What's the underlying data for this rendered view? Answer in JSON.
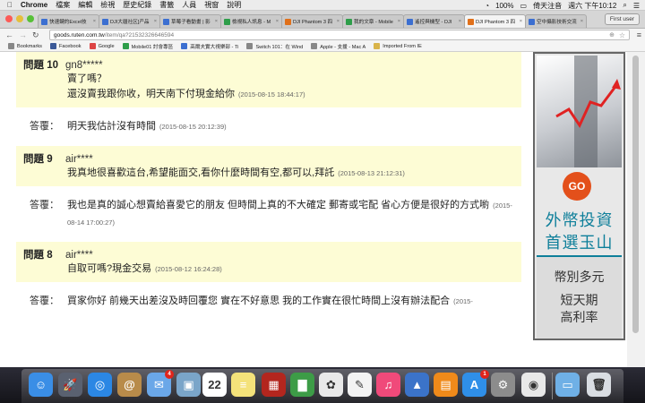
{
  "menubar": {
    "app": "Chrome",
    "items": [
      "檔案",
      "編輯",
      "檢視",
      "歷史紀錄",
      "書籤",
      "人員",
      "視窗",
      "說明"
    ],
    "status": {
      "battery": "100%",
      "input": "倚天注音",
      "datetime": "週六 下午10:12"
    }
  },
  "tabs": [
    {
      "label": "快速鍵的Excel技",
      "color": "#3c6fd1"
    },
    {
      "label": "DJI大疆社区]产品",
      "color": "#3c6fd1"
    },
    {
      "label": "草莓子看動畫 | 影",
      "color": "#3c6fd1"
    },
    {
      "label": "檢視私人訊息 - M",
      "color": "#2e9e4a"
    },
    {
      "label": "DJI Phantom 3 四",
      "color": "#e0701a"
    },
    {
      "label": "我的文章 - Mobile",
      "color": "#2e9e4a"
    },
    {
      "label": "遙控與機型 - DJI",
      "color": "#3c6fd1"
    },
    {
      "label": "DJI Phantom 3 四",
      "color": "#e0701a"
    },
    {
      "label": "空中攝影技術交流",
      "color": "#3c6fd1"
    }
  ],
  "active_tab": 7,
  "user_button": "First user",
  "url": {
    "host": "goods.ruten.com.tw",
    "path": "/item/qa?21532326646594"
  },
  "bookmarks": [
    {
      "label": "Bookmarks",
      "color": "#888"
    },
    {
      "label": "Facebook",
      "color": "#3b5998"
    },
    {
      "label": "Google",
      "color": "#d44"
    },
    {
      "label": "Mobile01 討會專區",
      "color": "#2e9e4a"
    },
    {
      "label": "高爾夫實大視樂部 - Ti",
      "color": "#3c6fd1"
    },
    {
      "label": "Switch 101：在 Wind",
      "color": "#888"
    },
    {
      "label": "Apple - 支援 - Mac A",
      "color": "#888"
    },
    {
      "label": "Imported From IE",
      "color": "#d9b44a"
    }
  ],
  "qa": [
    {
      "type": "q",
      "label": "問題",
      "num": "10",
      "user": "gn8*****",
      "lines": [
        {
          "text": "賣了嗎？",
          "date": ""
        },
        {
          "text": "還沒賣我跟你收，明天南下付現金給你",
          "date": "(2015-08-15 18:44:17)"
        }
      ]
    },
    {
      "type": "a",
      "label": "答覆：",
      "text": "明天我估計沒有時間",
      "date": "(2015-08-15 20:12:39)"
    },
    {
      "type": "q",
      "label": "問題",
      "num": "9",
      "user": "air****",
      "lines": [
        {
          "text": "我真地很喜歡這台,希望能面交,看你什麼時間有空,都可以,拜託",
          "date": "(2015-08-13 21:12:31)"
        }
      ]
    },
    {
      "type": "a",
      "label": "答覆：",
      "text": "我也是真的誠心想賣給喜愛它的朋友 但時間上真的不大確定 郵寄或宅配 省心方便是很好的方式喲",
      "date": "(2015-08-14 17:00:27)"
    },
    {
      "type": "q",
      "label": "問題",
      "num": "8",
      "user": "air****",
      "lines": [
        {
          "text": "自取可嗎?現金交易",
          "date": "(2015-08-12 16:24:28)"
        }
      ]
    },
    {
      "type": "a",
      "label": "答覆：",
      "text": "買家你好 前幾天出差沒及時回覆您 實在不好意思 我的工作實在很忙時間上沒有辦法配合",
      "date": "(2015-"
    }
  ],
  "ad": {
    "go": "GO",
    "line1": "外幣投資",
    "line2": "首選玉山",
    "line3": "幣別多元",
    "line4": "短天期",
    "line5": "高利率",
    "accent": "#0e7f9a"
  },
  "dock": [
    {
      "name": "finder-icon",
      "color": "#3a8ee6",
      "glyph": "☺"
    },
    {
      "name": "launchpad-icon",
      "color": "#5a6170",
      "glyph": "🚀"
    },
    {
      "name": "safari-icon",
      "color": "#2b87e4",
      "glyph": "◎"
    },
    {
      "name": "contacts-icon",
      "color": "#b88b4a",
      "glyph": "@"
    },
    {
      "name": "mail-icon",
      "color": "#6aa7e8",
      "glyph": "✉",
      "badge": "4"
    },
    {
      "name": "preview-icon",
      "color": "#7aa5c9",
      "glyph": "▣"
    },
    {
      "name": "calendar-icon",
      "color": "#ffffff",
      "glyph": "22"
    },
    {
      "name": "notes-icon",
      "color": "#f4e27a",
      "glyph": "≡"
    },
    {
      "name": "photo-booth-icon",
      "color": "#b3261e",
      "glyph": "▦"
    },
    {
      "name": "numbers-icon",
      "color": "#3d9c47",
      "glyph": "▇"
    },
    {
      "name": "photos-icon",
      "color": "#e9e9e9",
      "glyph": "✿"
    },
    {
      "name": "textedit-icon",
      "color": "#f3f3f3",
      "glyph": "✎"
    },
    {
      "name": "itunes-icon",
      "color": "#f04a7a",
      "glyph": "♫"
    },
    {
      "name": "keynote-icon",
      "color": "#3b73c9",
      "glyph": "▲"
    },
    {
      "name": "ibooks-icon",
      "color": "#f08a1a",
      "glyph": "▤"
    },
    {
      "name": "app-store-icon",
      "color": "#2f8fe8",
      "glyph": "A",
      "badge": "1"
    },
    {
      "name": "system-preferences-icon",
      "color": "#8c8c8c",
      "glyph": "⚙"
    },
    {
      "name": "chrome-icon",
      "color": "#e8e8e8",
      "glyph": "◉"
    },
    {
      "name": "downloads-folder-icon",
      "color": "#6fb0e6",
      "glyph": "▭"
    },
    {
      "name": "trash-icon",
      "color": "#d9dde2",
      "glyph": "🗑"
    }
  ]
}
